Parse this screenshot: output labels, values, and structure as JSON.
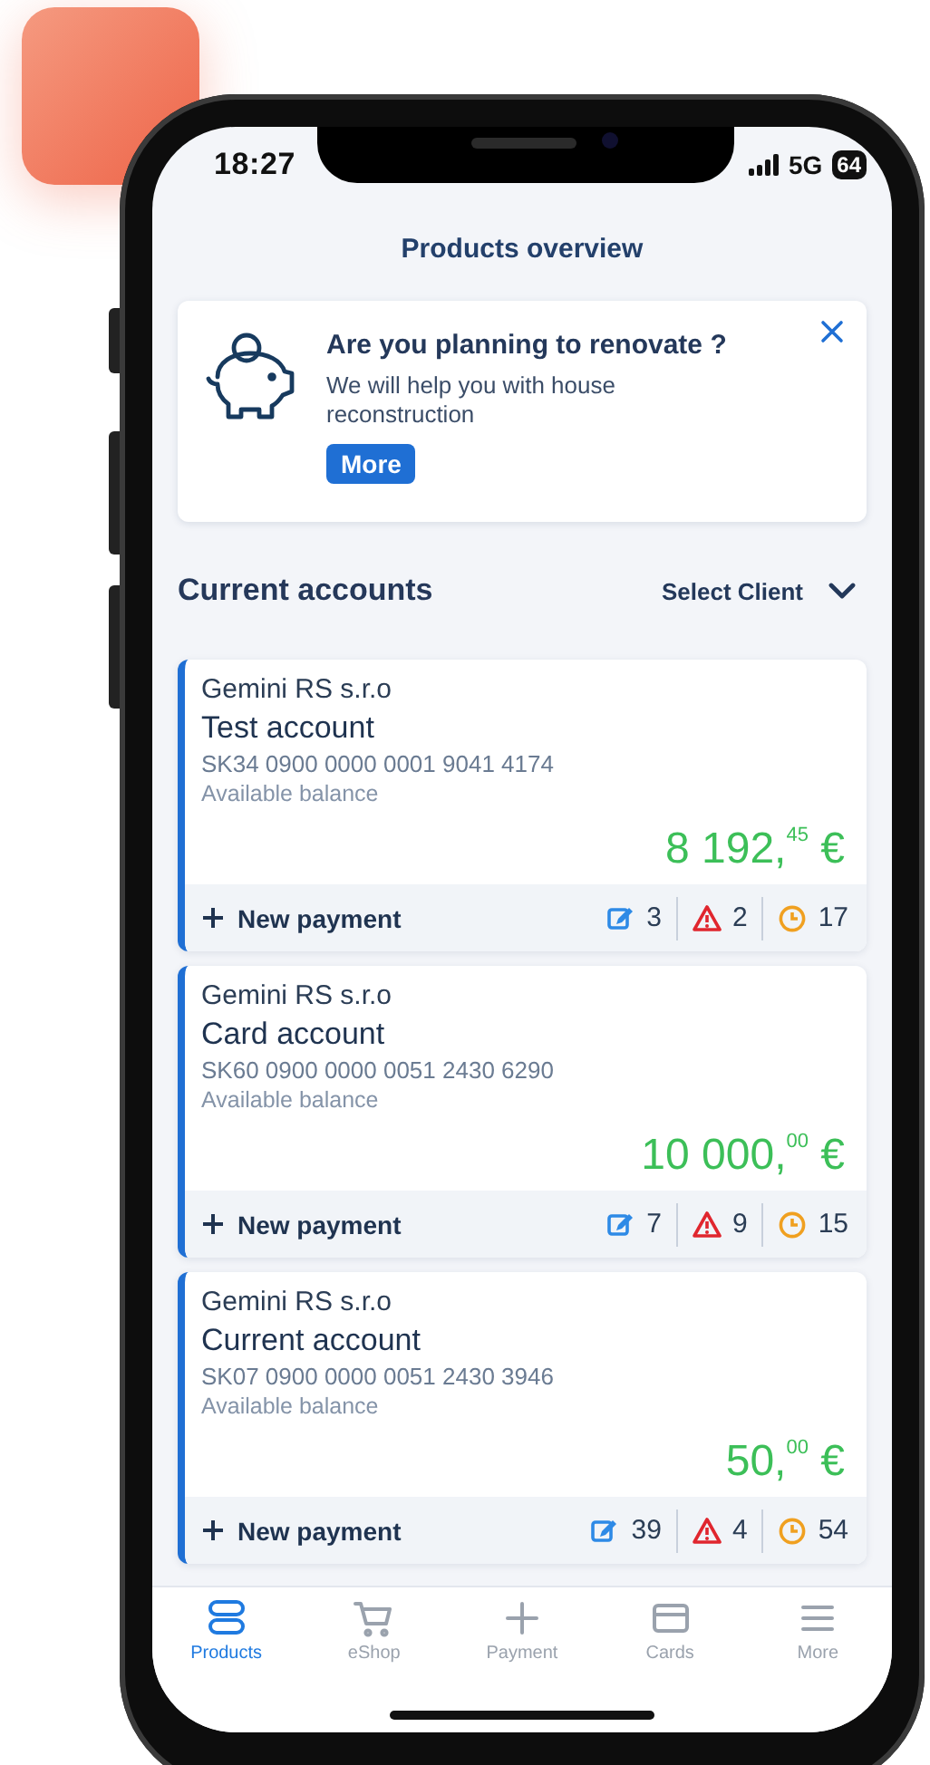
{
  "status_bar": {
    "time": "18:27",
    "network": "5G",
    "battery": "64"
  },
  "header": {
    "title": "Products overview"
  },
  "promo": {
    "title": "Are you planning to renovate ?",
    "text": "We will help you with house reconstruction",
    "button": "More"
  },
  "section": {
    "title": "Current accounts",
    "client_select": "Select Client"
  },
  "accounts": [
    {
      "company": "Gemini RS s.r.o",
      "name": "Test account",
      "iban": "SK34 0900 0000 0001 9041 4174",
      "balance_label": "Available balance",
      "amount": "8 192,$^{45}$ €",
      "action": "New payment",
      "counters": [
        {
          "kind": "edit",
          "value": "3"
        },
        {
          "kind": "alert",
          "value": "2"
        },
        {
          "kind": "pending",
          "value": "17"
        }
      ]
    },
    {
      "company": "Gemini RS s.r.o",
      "name": "Card account",
      "iban": "SK60 0900 0000 0051 2430 6290",
      "balance_label": "Available balance",
      "amount": "10 000,$^{00}$ €",
      "action": "New payment",
      "counters": [
        {
          "kind": "edit",
          "value": "7"
        },
        {
          "kind": "alert",
          "value": "9"
        },
        {
          "kind": "pending",
          "value": "15"
        }
      ]
    },
    {
      "company": "Gemini RS s.r.o",
      "name": "Current account",
      "iban": "SK07 0900 0000 0051 2430 3946",
      "balance_label": "Available balance",
      "amount": "50,$^{00}$ €",
      "action": "New payment",
      "counters": [
        {
          "kind": "edit",
          "value": "39"
        },
        {
          "kind": "alert",
          "value": "4"
        },
        {
          "kind": "pending",
          "value": "54"
        }
      ]
    }
  ],
  "tabs": [
    {
      "kind": "products",
      "label": "Products",
      "selected": true
    },
    {
      "kind": "eshop",
      "label": "eShop",
      "selected": false
    },
    {
      "kind": "payment",
      "label": "Payment",
      "selected": false
    },
    {
      "kind": "cards",
      "label": "Cards",
      "selected": false
    },
    {
      "kind": "more",
      "label": "More",
      "selected": false
    }
  ]
}
